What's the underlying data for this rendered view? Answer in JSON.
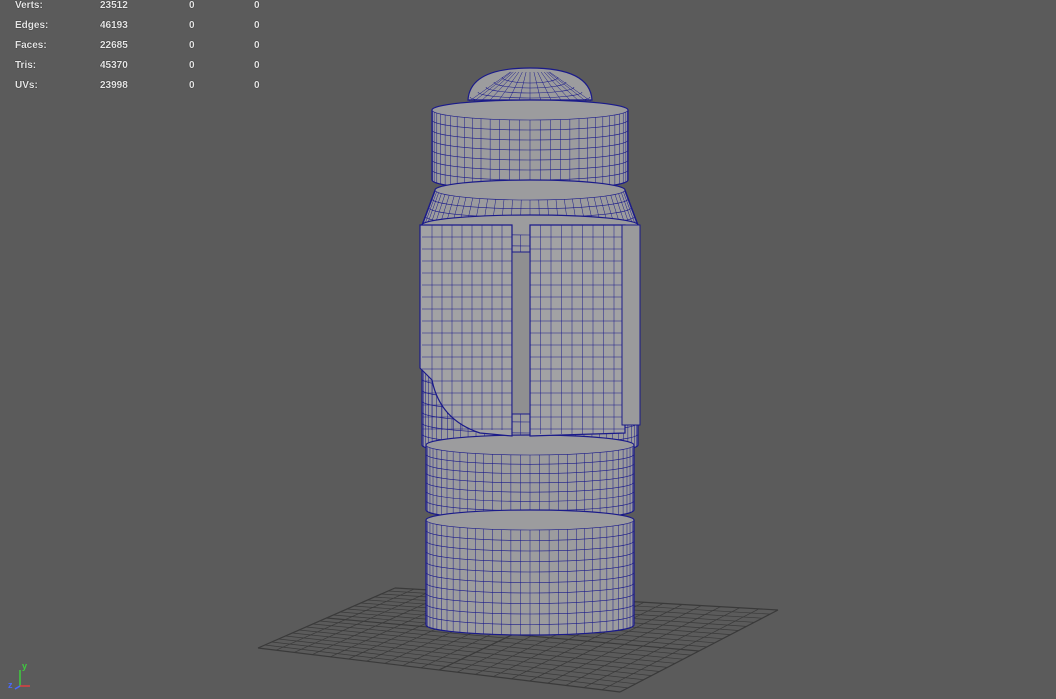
{
  "heads_up_display": {
    "rows": [
      {
        "label": "Verts:",
        "total": "23512",
        "selected": "0",
        "highlighted": "0"
      },
      {
        "label": "Edges:",
        "total": "46193",
        "selected": "0",
        "highlighted": "0"
      },
      {
        "label": "Faces:",
        "total": "22685",
        "selected": "0",
        "highlighted": "0"
      },
      {
        "label": "Tris:",
        "total": "45370",
        "selected": "0",
        "highlighted": "0"
      },
      {
        "label": "UVs:",
        "total": "23998",
        "selected": "0",
        "highlighted": "0"
      }
    ]
  },
  "view_axis": {
    "y": "y",
    "z": "z",
    "x": "x"
  },
  "colors": {
    "background": "#5b5b5b",
    "grid": "#3a3a3a",
    "wireframe": "#1a1a8a",
    "model_fill": "#9c9c9e",
    "hud_text": "#e6e6e6",
    "axis_y": "#3ecc3e",
    "axis_z": "#4a6aff",
    "axis_x": "#e04040"
  }
}
